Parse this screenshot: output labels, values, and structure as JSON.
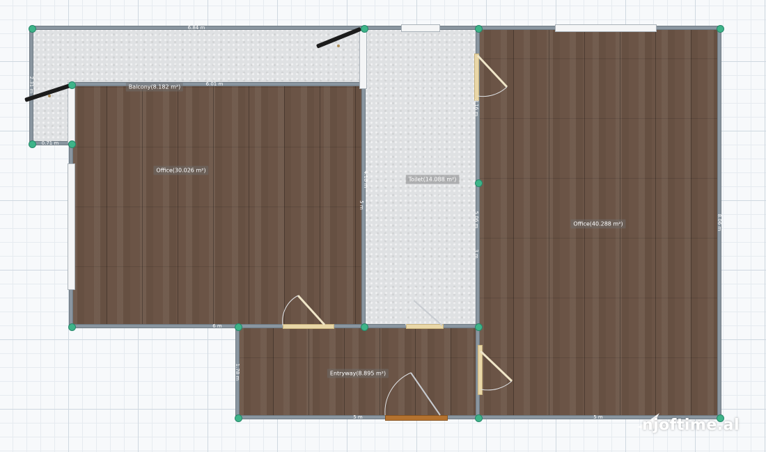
{
  "rooms": {
    "balcony": "Balcony(8.182 m²)",
    "office_left": "Office(30.026 m²)",
    "toilet": "Toilet(14.088 m²)",
    "office_right": "Office(40.288 m²)",
    "entryway": "Entryway(8.895 m²)"
  },
  "dimensions": {
    "balcony_top": "6.84 m",
    "balcony_left": "2.31 m",
    "balcony_bottom": "0.71 m",
    "office_left_top": "6.01 m",
    "office_left_bottom": "6 m",
    "office_left_right": "5 m",
    "toilet_left": "4.18 m",
    "toilet_right": "5.06 m",
    "toilet_right_upper": "3.16 m",
    "toilet_right_lower": "3 m",
    "office_right_right": "8.06 m",
    "office_right_bottom": "5 m",
    "entryway_left": "1.78 m",
    "entryway_bottom": "5 m"
  },
  "watermark": "njoftime.al",
  "colors": {
    "wood": "#6b5446",
    "tile": "#dfe1e3",
    "wall": "#8a96a0",
    "node": "#3eb489"
  }
}
